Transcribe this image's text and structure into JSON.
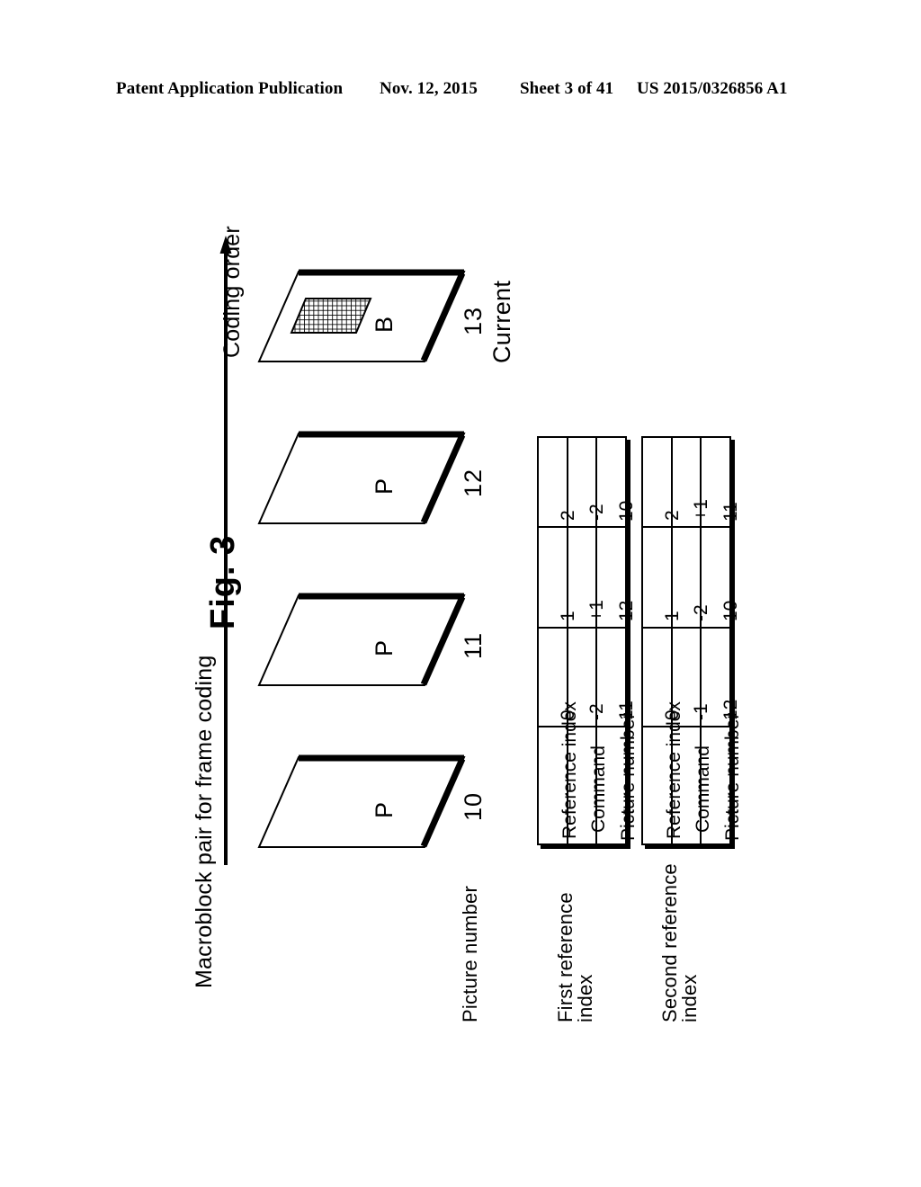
{
  "header": {
    "publication": "Patent Application Publication",
    "date": "Nov. 12, 2015",
    "sheet": "Sheet 3 of 41",
    "patent_number": "US 2015/0326856 A1"
  },
  "figure": {
    "title": "Fig. 3",
    "caption": "Macroblock pair for frame coding",
    "axis_label": "Coding order",
    "picture_number_label": "Picture number",
    "frames": [
      {
        "letter": "P",
        "number": "10",
        "note": "",
        "hatched": false
      },
      {
        "letter": "P",
        "number": "11",
        "note": "",
        "hatched": false
      },
      {
        "letter": "P",
        "number": "12",
        "note": "",
        "hatched": false
      },
      {
        "letter": "B",
        "number": "13",
        "note": "Current",
        "hatched": true
      }
    ]
  },
  "tables": [
    {
      "label_line1": "First reference",
      "label_line2": "index",
      "rows": [
        {
          "header": "Reference index",
          "values": [
            "0",
            "1",
            "2"
          ]
        },
        {
          "header": "Command",
          "values": [
            "-2",
            "+1",
            "-2"
          ]
        },
        {
          "header": "Picture number",
          "values": [
            "11",
            "12",
            "10"
          ]
        }
      ]
    },
    {
      "label_line1": "Second reference",
      "label_line2": "index",
      "rows": [
        {
          "header": "Reference index",
          "values": [
            "0",
            "1",
            "2"
          ]
        },
        {
          "header": "Command",
          "values": [
            "-1",
            "-2",
            "+1"
          ]
        },
        {
          "header": "Picture number",
          "values": [
            "12",
            "10",
            "11"
          ]
        }
      ]
    }
  ],
  "colors": {
    "ink": "#000000",
    "paper": "#ffffff"
  }
}
